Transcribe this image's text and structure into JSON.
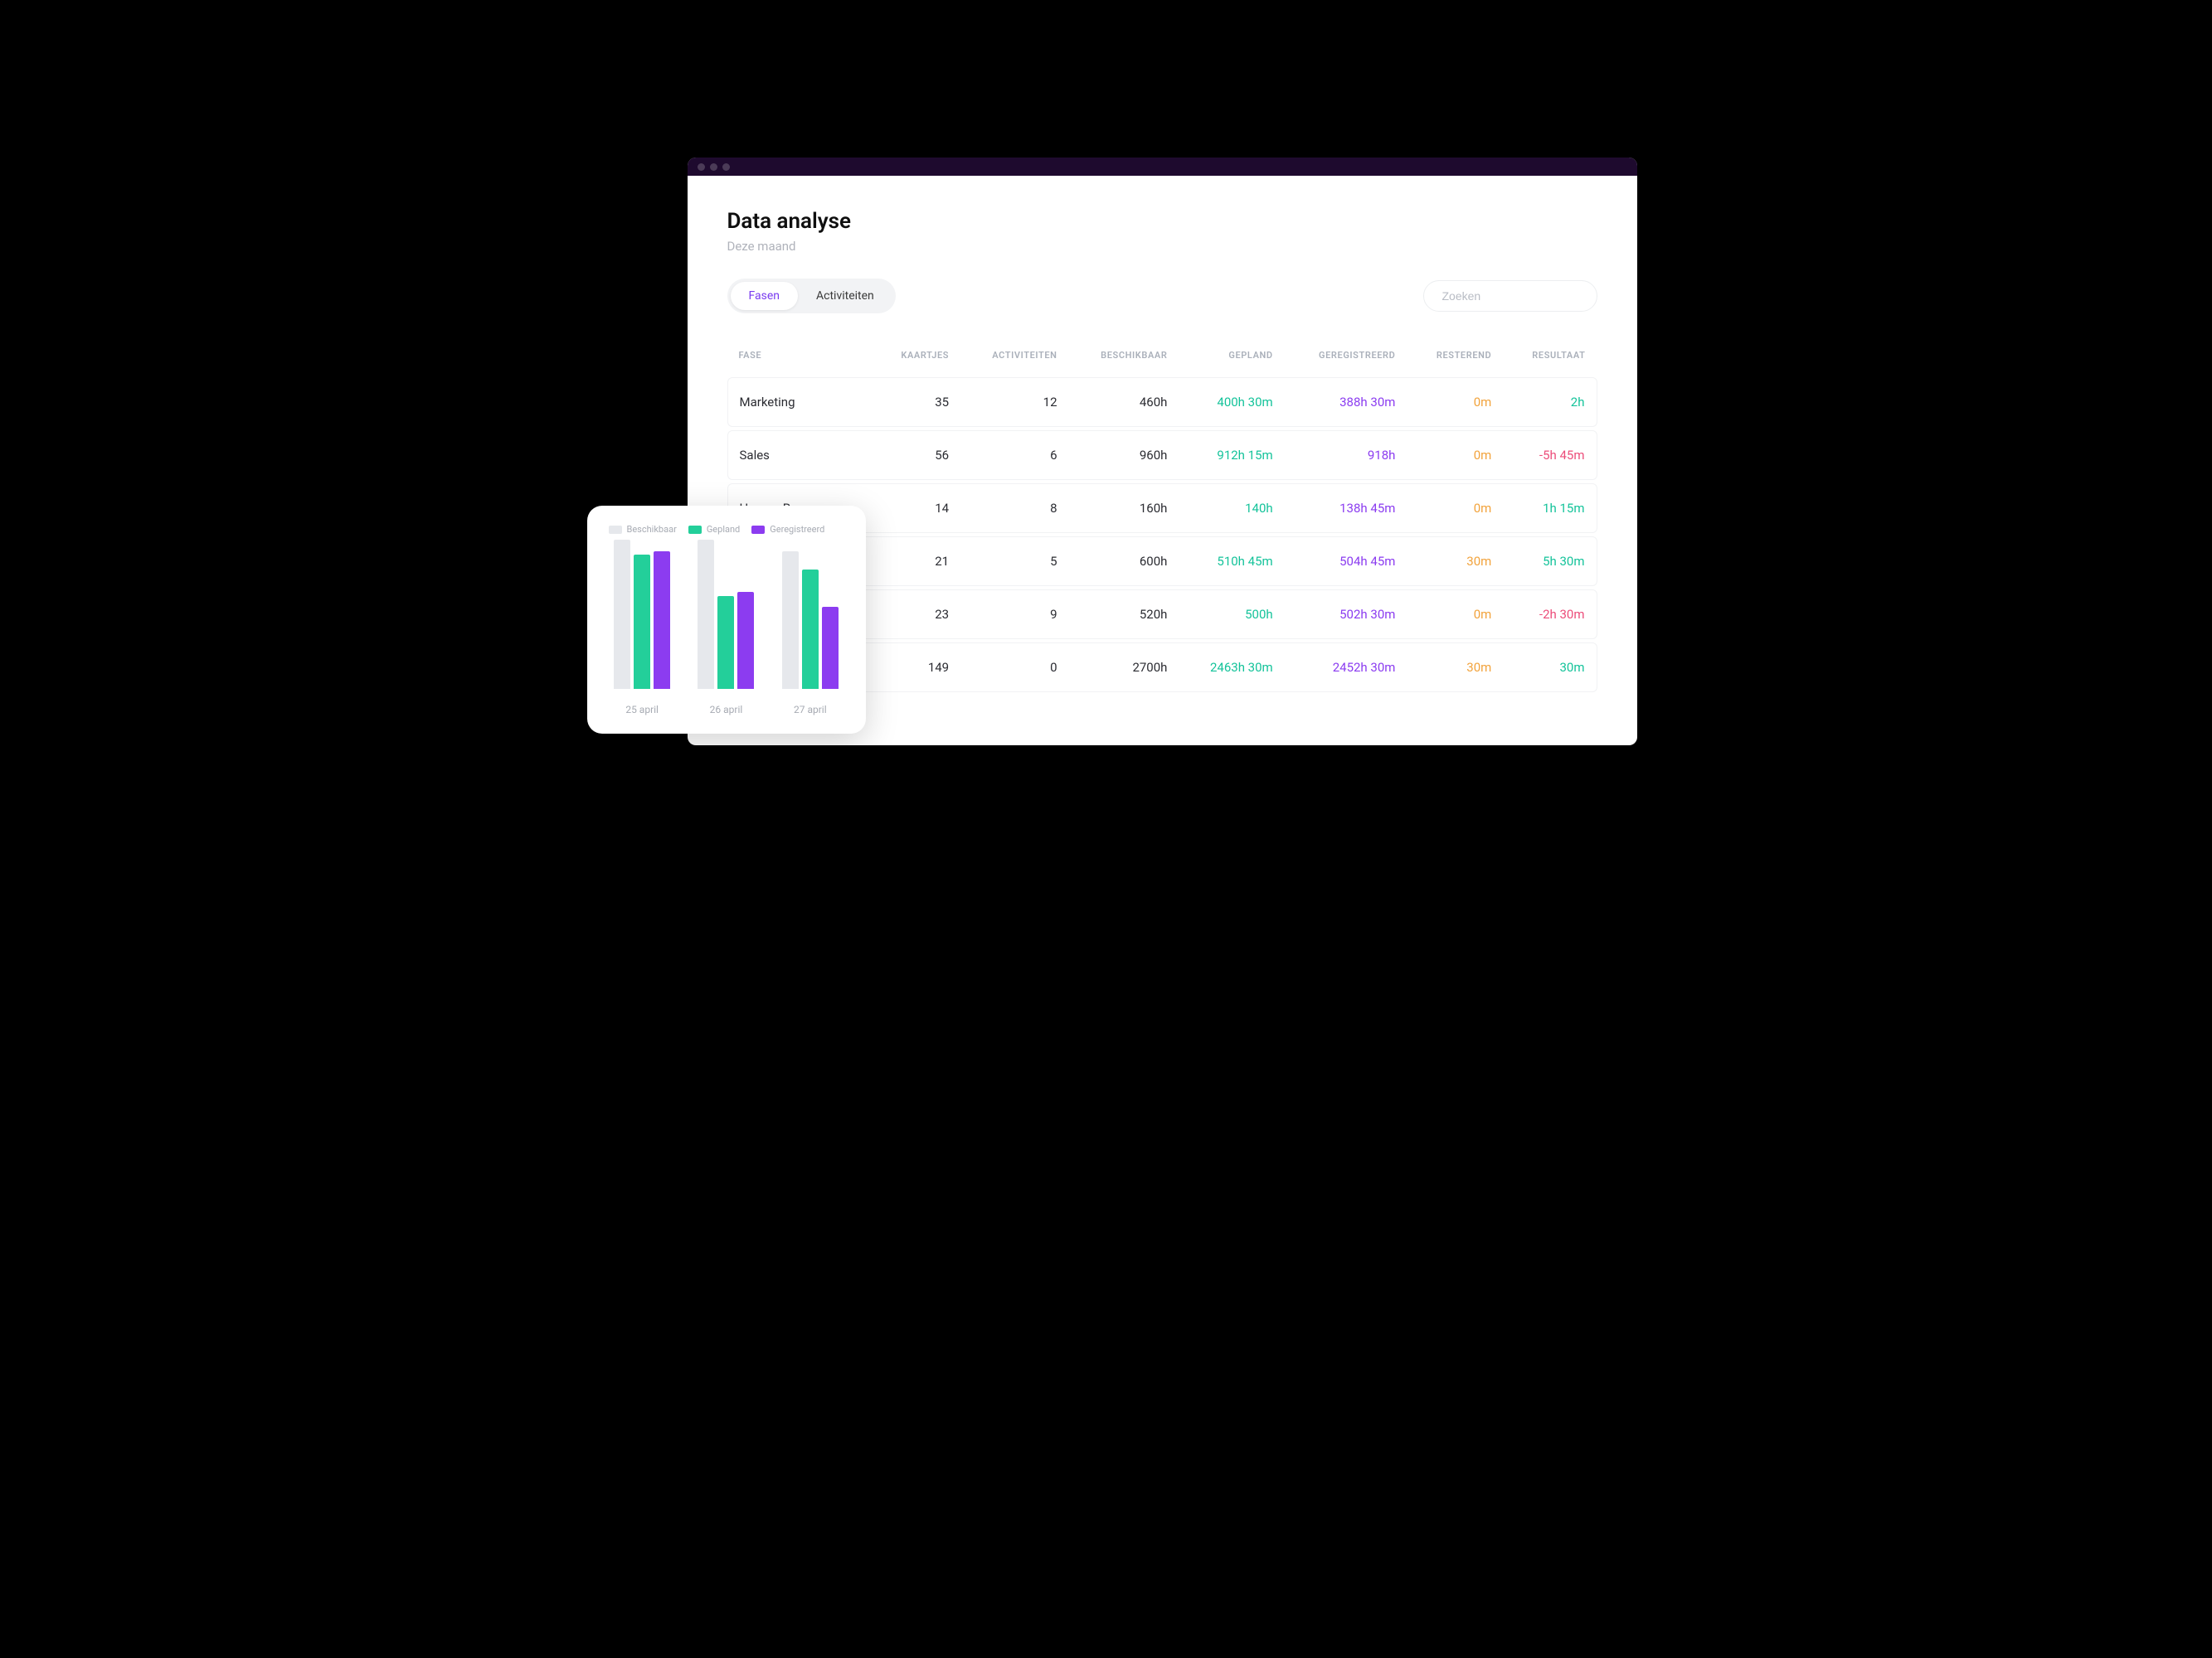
{
  "page": {
    "title": "Data analyse",
    "subtitle": "Deze maand"
  },
  "tabs": {
    "fasen": "Fasen",
    "activiteiten": "Activiteiten"
  },
  "search": {
    "placeholder": "Zoeken"
  },
  "columns": {
    "fase": "Fase",
    "kaartjes": "Kaartjes",
    "activiteiten": "Activiteiten",
    "beschikbaar": "Beschikbaar",
    "gepland": "Gepland",
    "geregistreerd": "Geregistreerd",
    "resterend": "Resterend",
    "resultaat": "Resultaat"
  },
  "rows": [
    {
      "fase": "Marketing",
      "kaartjes": "35",
      "activiteiten": "12",
      "beschikbaar": "460h",
      "gepland": "400h 30m",
      "geregistreerd": "388h 30m",
      "resterend": "0m",
      "resultaat": "2h",
      "result_class": "c-green"
    },
    {
      "fase": "Sales",
      "kaartjes": "56",
      "activiteiten": "6",
      "beschikbaar": "960h",
      "gepland": "912h 15m",
      "geregistreerd": "918h",
      "resterend": "0m",
      "resultaat": "-5h 45m",
      "result_class": "c-pink"
    },
    {
      "fase": "Human Resource",
      "kaartjes": "14",
      "activiteiten": "8",
      "beschikbaar": "160h",
      "gepland": "140h",
      "geregistreerd": "138h 45m",
      "resterend": "0m",
      "resultaat": "1h 15m",
      "result_class": "c-green"
    },
    {
      "fase": "",
      "kaartjes": "21",
      "activiteiten": "5",
      "beschikbaar": "600h",
      "gepland": "510h 45m",
      "geregistreerd": "504h 45m",
      "resterend": "30m",
      "resultaat": "5h 30m",
      "result_class": "c-green"
    },
    {
      "fase": "",
      "kaartjes": "23",
      "activiteiten": "9",
      "beschikbaar": "520h",
      "gepland": "500h",
      "geregistreerd": "502h 30m",
      "resterend": "0m",
      "resultaat": "-2h 30m",
      "result_class": "c-pink"
    },
    {
      "fase": "",
      "kaartjes": "149",
      "activiteiten": "0",
      "beschikbaar": "2700h",
      "gepland": "2463h 30m",
      "geregistreerd": "2452h 30m",
      "resterend": "30m",
      "resultaat": "30m",
      "result_class": "c-green"
    }
  ],
  "chart_legend": {
    "beschikbaar": "Beschikbaar",
    "gepland": "Gepland",
    "geregistreerd": "Geregistreerd"
  },
  "chart_data": {
    "type": "bar",
    "categories": [
      "25 april",
      "26 april",
      "27 april"
    ],
    "series": [
      {
        "name": "Beschikbaar",
        "values": [
          100,
          100,
          92
        ]
      },
      {
        "name": "Gepland",
        "values": [
          90,
          62,
          80
        ]
      },
      {
        "name": "Geregistreerd",
        "values": [
          92,
          65,
          55
        ]
      }
    ],
    "ylim": [
      0,
      100
    ]
  }
}
